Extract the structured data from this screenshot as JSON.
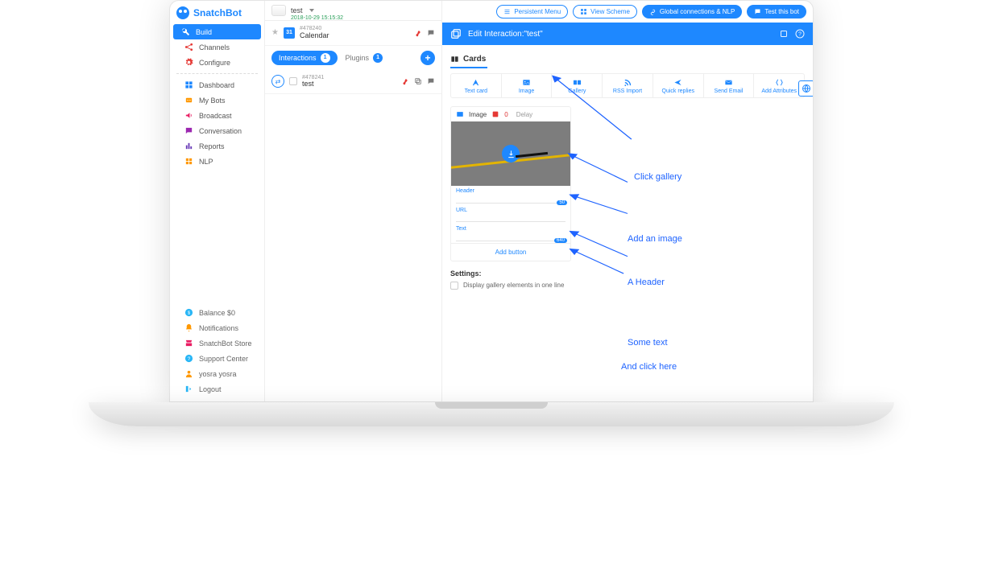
{
  "brand": "SnatchBot",
  "nav": {
    "build": "Build",
    "items": [
      "Channels",
      "Configure"
    ],
    "dash": [
      "Dashboard",
      "My Bots",
      "Broadcast",
      "Conversation",
      "Reports",
      "NLP"
    ]
  },
  "sidebar_bottom": {
    "balance": "Balance $0",
    "notifications": "Notifications",
    "store": "SnatchBot Store",
    "support": "Support Center",
    "user": "yosra yosra",
    "logout": "Logout"
  },
  "bot": {
    "name": "test",
    "date": "2018-10-29 15:15:32"
  },
  "interactions_tab": {
    "label": "Interactions",
    "count": "1"
  },
  "plugins_tab": {
    "label": "Plugins",
    "count": "1"
  },
  "interaction_calendar": {
    "id": "#478240",
    "name": "Calendar",
    "day": "31"
  },
  "interaction_test": {
    "id": "#478241",
    "name": "test"
  },
  "toolbar": {
    "persistent": "Persistent Menu",
    "scheme": "View Scheme",
    "nlp": "Global connections & NLP",
    "test": "Test this bot"
  },
  "editor": {
    "title": "Edit Interaction:\"test\"",
    "cards_heading": "Cards",
    "types": [
      "Text card",
      "Image",
      "Gallery",
      "RSS Import",
      "Quick replies",
      "Send Email",
      "Add Attributes"
    ],
    "image_tab": "Image",
    "delay_tab": "Delay",
    "warn_count": "0",
    "fields": {
      "header": "Header",
      "header_counter": "50",
      "url": "URL",
      "text": "Text",
      "text_counter": "640"
    },
    "add_button": "Add button",
    "settings_label": "Settings:",
    "settings_opt": "Display gallery elements in one line"
  },
  "annotations": {
    "a1": "Click gallery",
    "a2": "Add an image",
    "a3": "A Header",
    "a4": "Some text",
    "a5": "And click here"
  }
}
